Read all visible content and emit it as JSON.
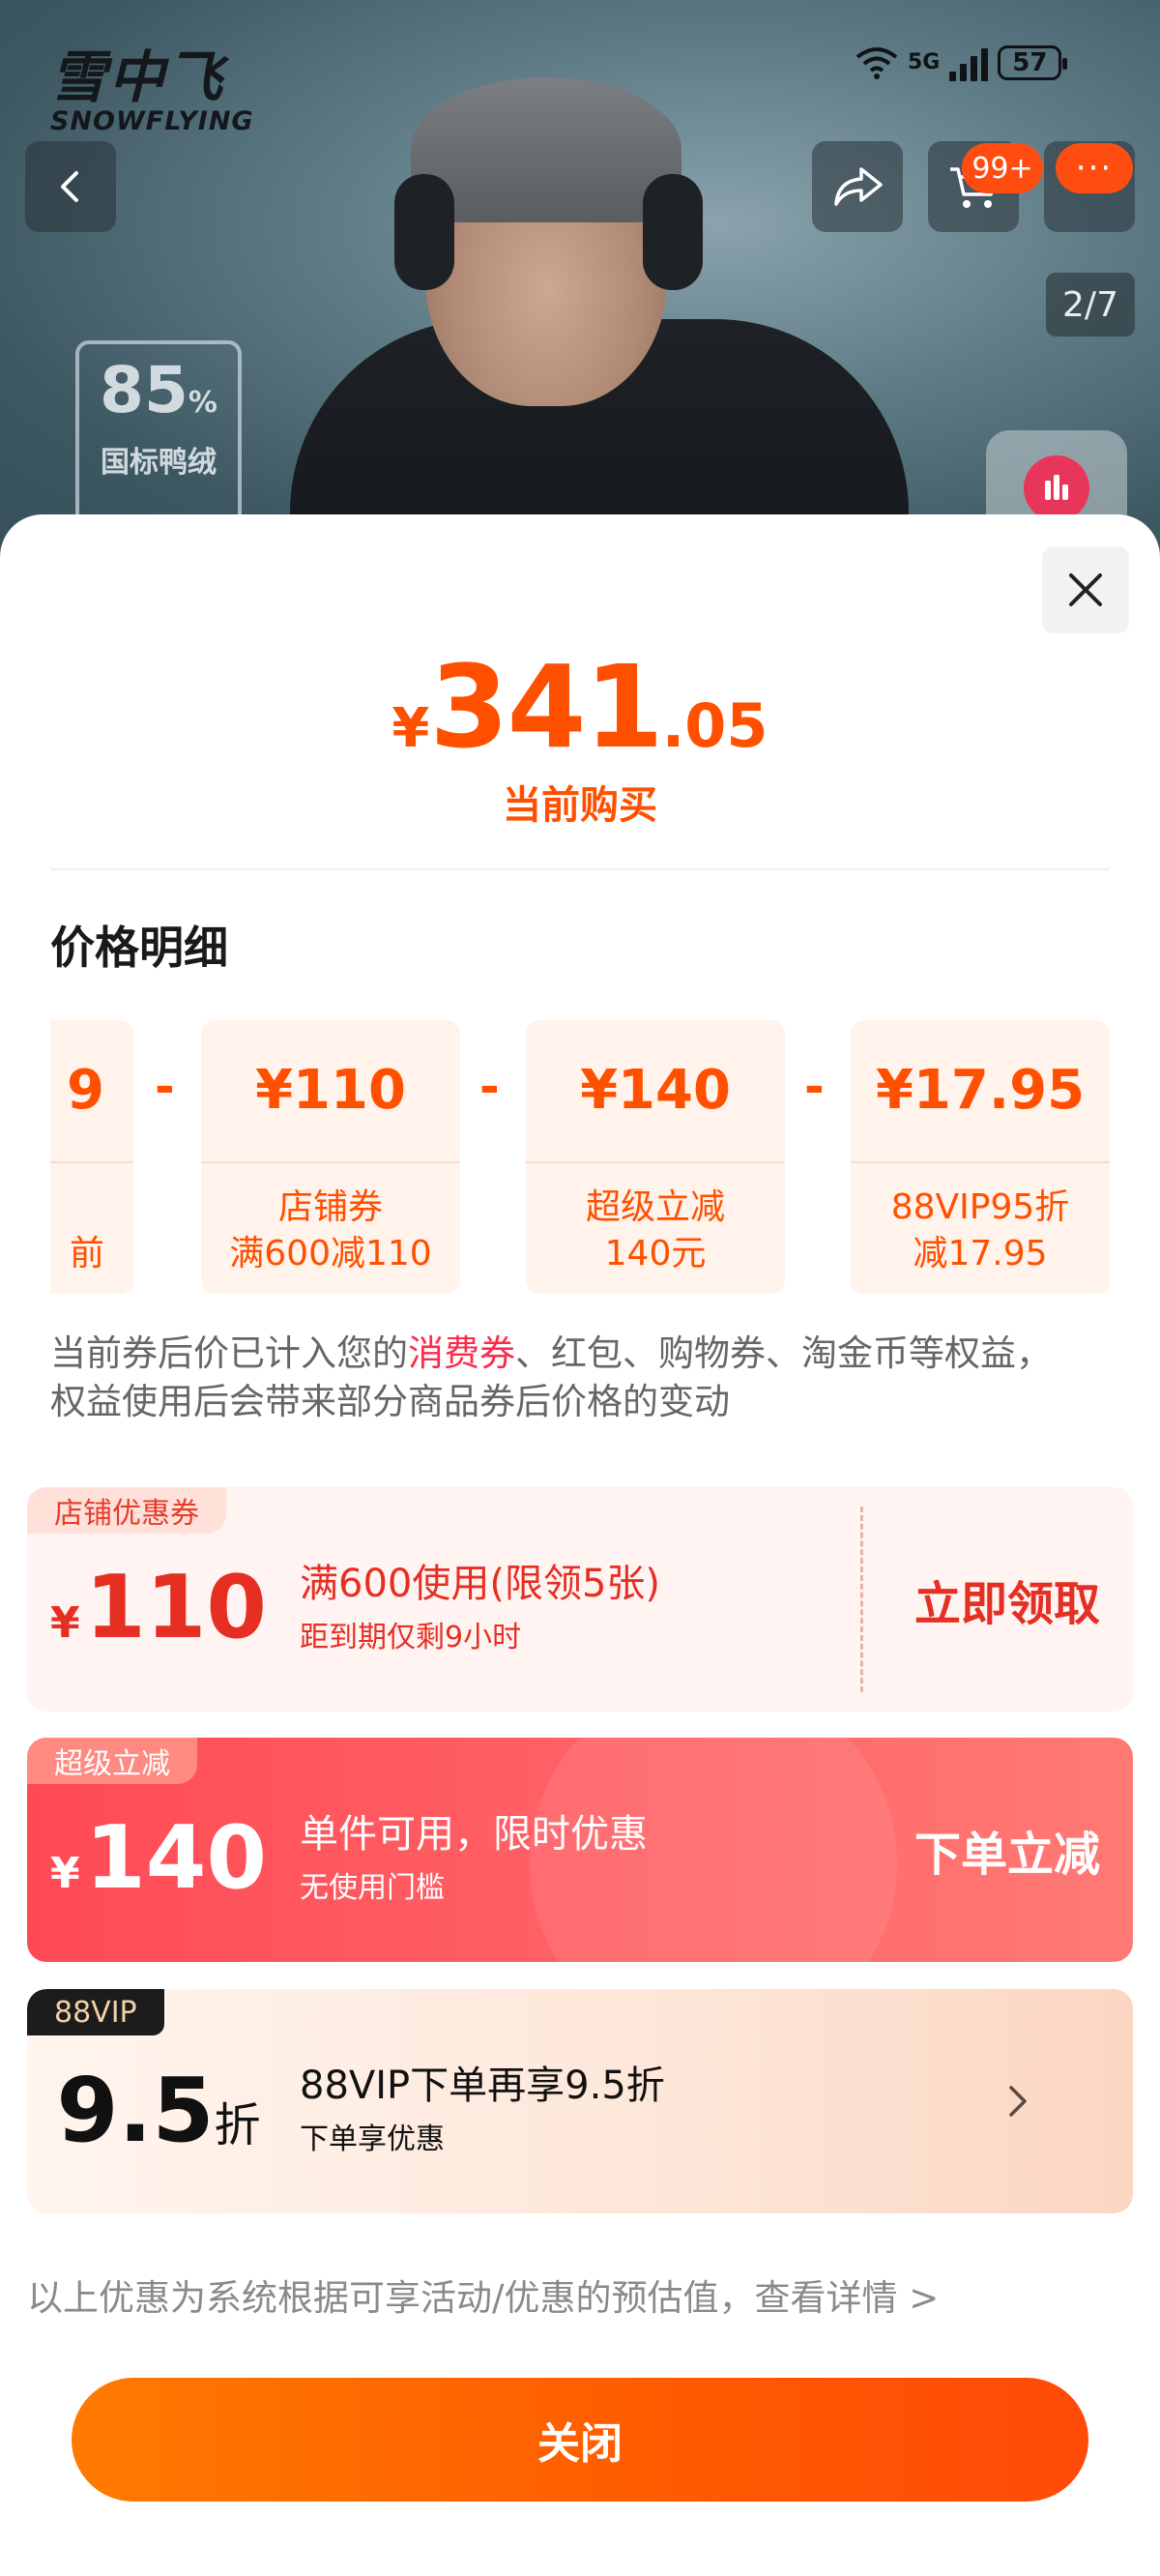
{
  "header": {
    "brand_name": "雪中飞",
    "brand_sub": "SNOWFLYING",
    "status": {
      "network": "5G",
      "battery": "57"
    },
    "cart_badge": "99+",
    "more_badge": "···",
    "image_counter": "2/7",
    "down_badge": {
      "percent": "85",
      "percent_unit": "%",
      "text": "国标鸭绒"
    }
  },
  "summary": {
    "currency": "¥",
    "price_int": "341",
    "price_dec": ".05",
    "label": "当前购买"
  },
  "price_detail": {
    "title": "价格明细",
    "cards": [
      {
        "amount": "9",
        "desc_line1": "",
        "desc_line2": "前"
      },
      {
        "amount": "¥110",
        "desc_line1": "店铺券",
        "desc_line2": "满600减110"
      },
      {
        "amount": "¥140",
        "desc_line1": "超级立减",
        "desc_line2": "140元"
      },
      {
        "amount": "¥17.95",
        "desc_line1": "88VIP95折",
        "desc_line2": "减17.95"
      }
    ],
    "minus_sign": "-"
  },
  "note": {
    "line1_prefix": "当前券后价已计入您的",
    "line1_highlight": "消费券",
    "line1_suffix": "、红包、购物券、淘金币等权益，",
    "line2": "权益使用后会带来部分商品券后价格的变动"
  },
  "coupons": [
    {
      "tag": "店铺优惠券",
      "currency": "¥",
      "value": "110",
      "title": "满600使用(限领5张)",
      "subtitle": "距到期仅剩9小时",
      "action": "立即领取"
    },
    {
      "tag": "超级立减",
      "currency": "¥",
      "value": "140",
      "title": "单件可用，限时优惠",
      "subtitle": "无使用门槛",
      "action": "下单立减"
    },
    {
      "tag": "88VIP",
      "value": "9.5",
      "unit": "折",
      "title": "88VIP下单再享9.5折",
      "subtitle": "下单享优惠"
    }
  ],
  "disclaimer": "以上优惠为系统根据可享活动/优惠的预估值，查看详情 >",
  "close_label": "关闭",
  "colors": {
    "accent": "#ff5000",
    "coupon_red": "#ff4a55",
    "highlight": "#ff2a4a"
  }
}
